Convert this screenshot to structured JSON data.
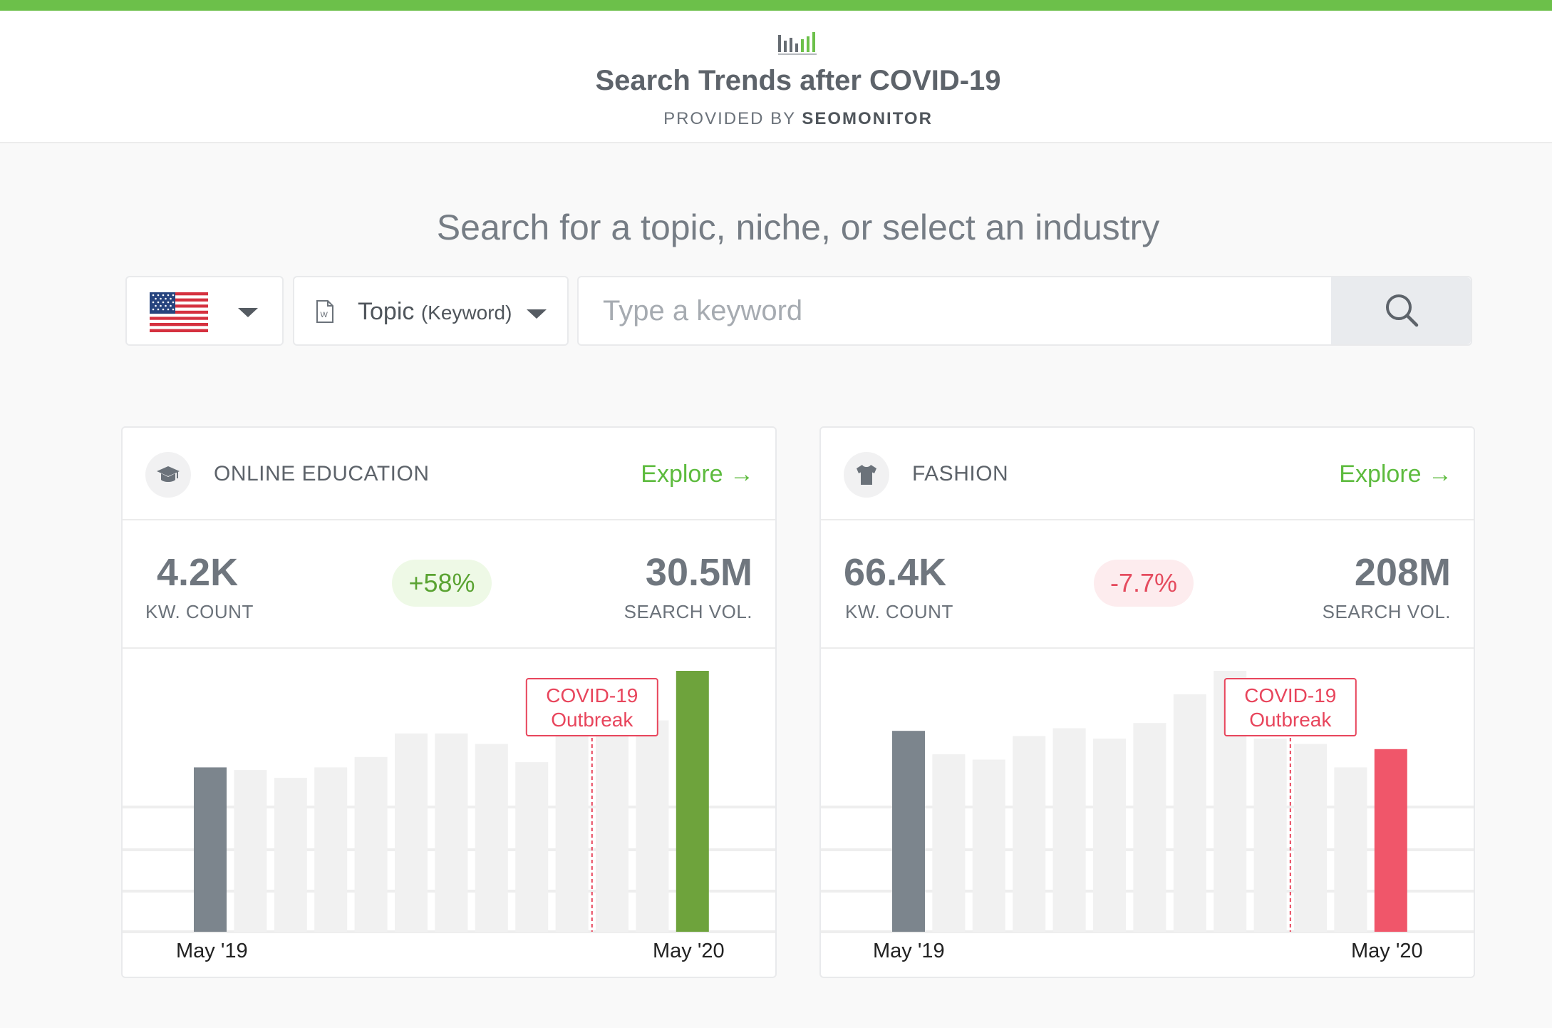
{
  "colors": {
    "accent_green": "#6cc04a",
    "explore_green": "#5dbb3e",
    "bar_growth": "#6ea33c",
    "bar_decline": "#f0566a",
    "bar_baseline": "#7c858d",
    "bar_neutral": "#f1f1f1",
    "outbreak_red": "#e8455c"
  },
  "header": {
    "logo_icon": "bar-chart-logo-icon",
    "title": "Search Trends after COVID-19",
    "subtitle_prefix": "PROVIDED BY",
    "subtitle_brand": "SEOMONITOR"
  },
  "search": {
    "heading": "Search for a topic, niche, or select an industry",
    "country_icon": "us-flag-icon",
    "topic_label": "Topic",
    "topic_sublabel": "(Keyword)",
    "keyword_placeholder": "Type a keyword",
    "search_icon": "search-icon"
  },
  "cards": [
    {
      "icon": "graduation-cap-icon",
      "name": "ONLINE EDUCATION",
      "explore_label": "Explore",
      "kw_count": "4.2K",
      "kw_count_label": "KW. COUNT",
      "change": "+58%",
      "change_direction": "up",
      "search_vol": "30.5M",
      "search_vol_label": "SEARCH VOL.",
      "outbreak_line1": "COVID-19",
      "outbreak_line2": "Outbreak",
      "x_start": "May '19",
      "x_end": "May '20"
    },
    {
      "icon": "t-shirt-icon",
      "name": "FASHION",
      "explore_label": "Explore",
      "kw_count": "66.4K",
      "kw_count_label": "KW. COUNT",
      "change": "-7.7%",
      "change_direction": "down",
      "search_vol": "208M",
      "search_vol_label": "SEARCH VOL.",
      "outbreak_line1": "COVID-19",
      "outbreak_line2": "Outbreak",
      "x_start": "May '19",
      "x_end": "May '20"
    }
  ],
  "chart_data": [
    {
      "type": "bar",
      "title": "ONLINE EDUCATION",
      "x": [
        "May '19",
        "",
        "",
        "",
        "",
        "",
        "",
        "",
        "",
        "",
        "",
        "",
        "May '20"
      ],
      "values": [
        63,
        62,
        59,
        63,
        67,
        76,
        76,
        72,
        65,
        78,
        80,
        81,
        100
      ],
      "ylim": [
        0,
        100
      ],
      "highlight": {
        "first": "baseline",
        "last": "growth"
      },
      "annotation": {
        "label": "COVID-19 Outbreak",
        "between_index": [
          9,
          10
        ]
      },
      "grid": true
    },
    {
      "type": "bar",
      "title": "FASHION",
      "x": [
        "May '19",
        "",
        "",
        "",
        "",
        "",
        "",
        "",
        "",
        "",
        "",
        "",
        "May '20"
      ],
      "values": [
        77,
        68,
        66,
        75,
        78,
        74,
        80,
        91,
        100,
        74,
        72,
        63,
        70
      ],
      "ylim": [
        0,
        100
      ],
      "highlight": {
        "first": "baseline",
        "last": "decline"
      },
      "annotation": {
        "label": "COVID-19 Outbreak",
        "between_index": [
          9,
          10
        ]
      },
      "grid": true
    }
  ]
}
